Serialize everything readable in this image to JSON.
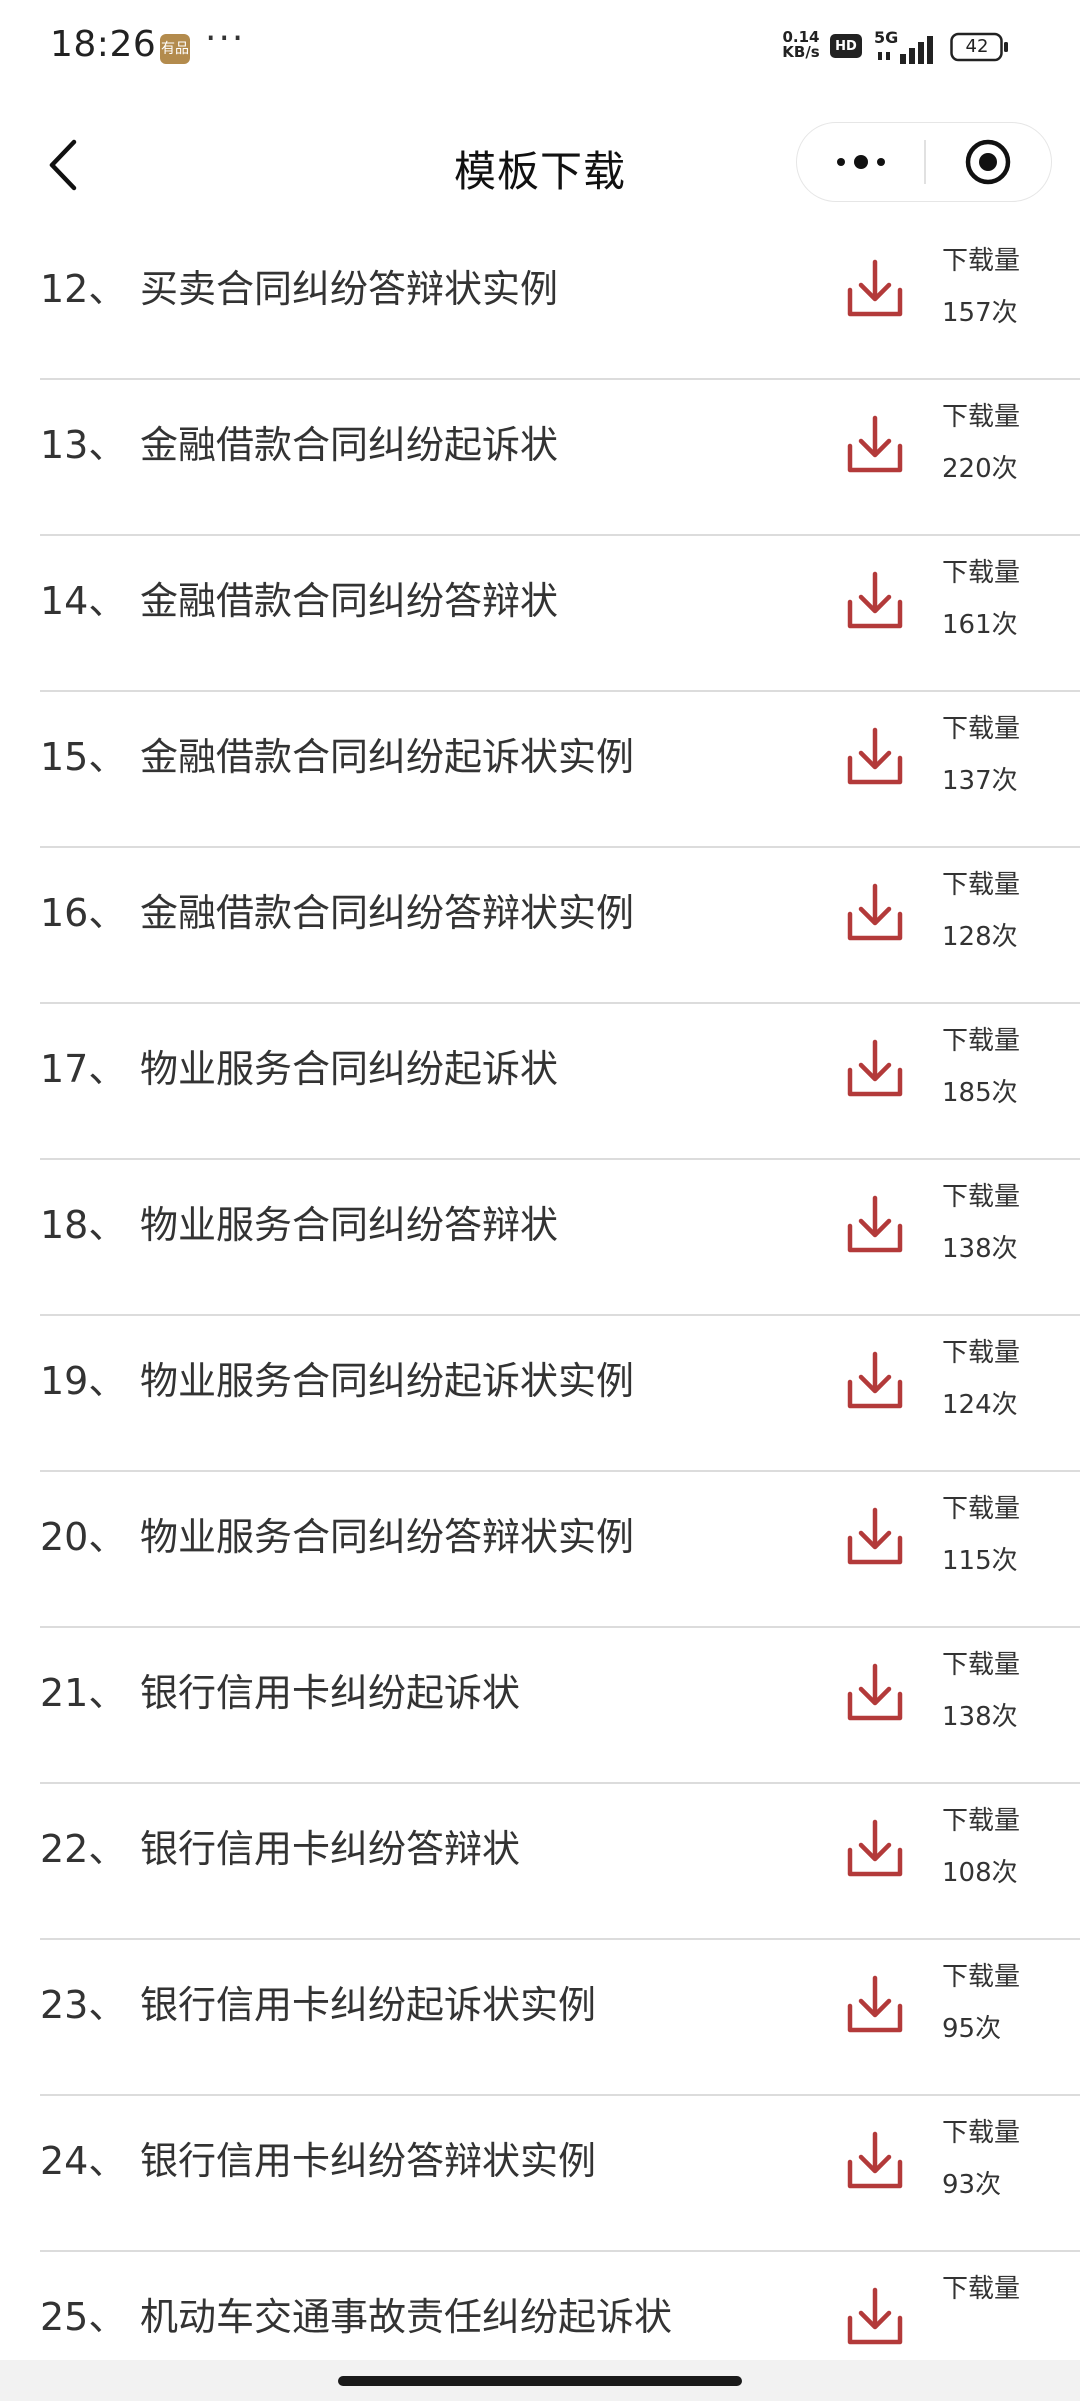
{
  "status_bar": {
    "time": "18:26",
    "app_badge": "有品",
    "dots": "···",
    "net_speed_value": "0.14",
    "net_speed_unit": "KB/s",
    "hd": "HD",
    "network": "5G",
    "battery": "42"
  },
  "nav": {
    "title": "模板下载"
  },
  "list": {
    "download_label": "下载量",
    "items": [
      {
        "index": "12、",
        "title": "买卖合同纠纷答辩状实例",
        "count": "157次"
      },
      {
        "index": "13、",
        "title": "金融借款合同纠纷起诉状",
        "count": "220次"
      },
      {
        "index": "14、",
        "title": "金融借款合同纠纷答辩状",
        "count": "161次"
      },
      {
        "index": "15、",
        "title": "金融借款合同纠纷起诉状实例",
        "count": "137次"
      },
      {
        "index": "16、",
        "title": "金融借款合同纠纷答辩状实例",
        "count": "128次"
      },
      {
        "index": "17、",
        "title": "物业服务合同纠纷起诉状",
        "count": "185次"
      },
      {
        "index": "18、",
        "title": "物业服务合同纠纷答辩状",
        "count": "138次"
      },
      {
        "index": "19、",
        "title": "物业服务合同纠纷起诉状实例",
        "count": "124次"
      },
      {
        "index": "20、",
        "title": "物业服务合同纠纷答辩状实例",
        "count": "115次"
      },
      {
        "index": "21、",
        "title": "银行信用卡纠纷起诉状",
        "count": "138次"
      },
      {
        "index": "22、",
        "title": "银行信用卡纠纷答辩状",
        "count": "108次"
      },
      {
        "index": "23、",
        "title": "银行信用卡纠纷起诉状实例",
        "count": "95次"
      },
      {
        "index": "24、",
        "title": "银行信用卡纠纷答辩状实例",
        "count": "93次"
      },
      {
        "index": "25、",
        "title": "机动车交通事故责任纠纷起诉状",
        "count": ""
      }
    ]
  },
  "colors": {
    "download_icon": "#b33a3a"
  }
}
